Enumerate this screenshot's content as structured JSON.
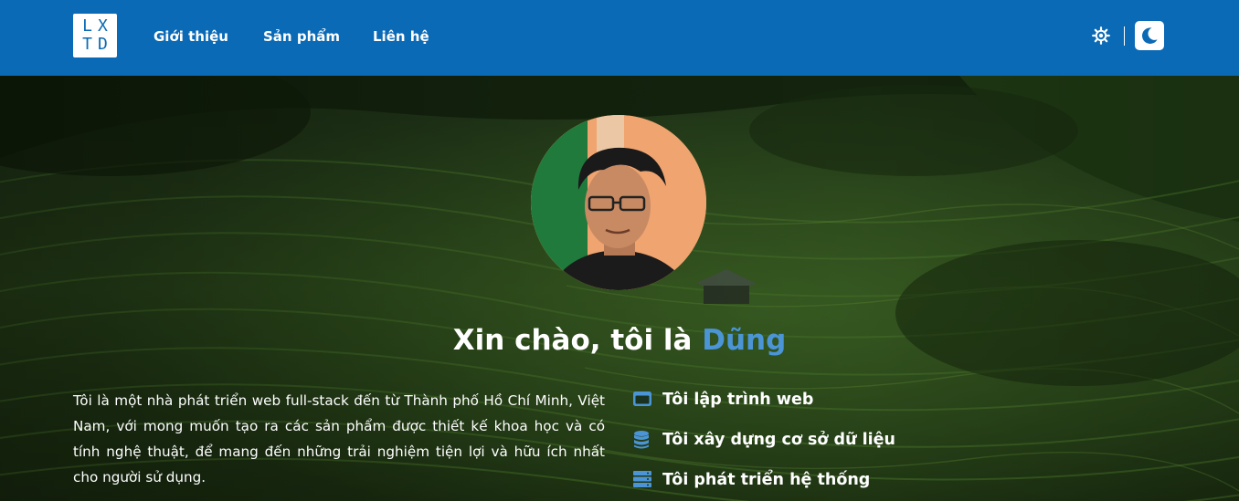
{
  "header": {
    "logo": {
      "line1": "LX",
      "line2": "TD"
    },
    "nav": [
      {
        "label": "Giới thiệu"
      },
      {
        "label": "Sản phẩm"
      },
      {
        "label": "Liên hệ"
      }
    ],
    "theme_toggle": {
      "light_icon": "sun-icon",
      "dark_icon": "moon-icon",
      "active": "dark"
    }
  },
  "hero": {
    "background": "rice-terraces-photo",
    "avatar": "profile-photo",
    "greeting": {
      "prefix": "Xin chào, tôi là",
      "name": "Dũng"
    },
    "intro": "Tôi là một nhà phát triển web full-stack đến từ Thành phố Hồ Chí Minh, Việt Nam, với mong muốn tạo ra các sản phẩm được thiết kế khoa học và có tính nghệ thuật, để mang đến những trải nghiệm tiện lợi và hữu ích nhất cho người sử dụng.",
    "skills": [
      {
        "icon": "browser-window-icon",
        "label": "Tôi lập trình web"
      },
      {
        "icon": "database-icon",
        "label": "Tôi xây dựng cơ sở dữ liệu"
      },
      {
        "icon": "server-icon",
        "label": "Tôi phát triển hệ thống"
      }
    ]
  },
  "colors": {
    "header_bg": "#0b6ab5",
    "accent": "#4b95d6",
    "icon_blue": "#4b95d6"
  }
}
